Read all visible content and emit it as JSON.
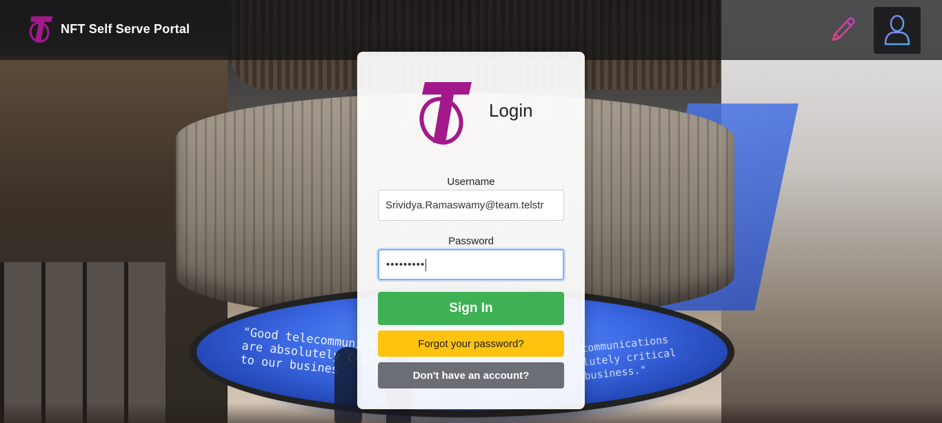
{
  "header": {
    "title": "NFT Self Serve Portal",
    "logo_icon": "telstra-t-logo",
    "edit_icon": "pencil-icon",
    "user_icon": "user-icon"
  },
  "login": {
    "title": "Login",
    "username_label": "Username",
    "username_value": "Srividya.Ramaswamy@team.telstr",
    "password_label": "Password",
    "password_mask": "•••••••••",
    "sign_in_label": "Sign In",
    "forgot_label": "Forgot your password?",
    "no_account_label": "Don't have an account?"
  },
  "background": {
    "quote_left_line1": "\"Good telecommunicat",
    "quote_left_line2": "are absolutely criti",
    "quote_left_line3": "to our busines",
    "quote_right_line1": "communications",
    "quote_right_line2": "lutely critical",
    "quote_right_line3": "business.\""
  },
  "colors": {
    "brand_magenta": "#a3198b",
    "sign_in": "#3db153",
    "forgot": "#ffc20e",
    "no_account": "#6b6e75",
    "header_bg": "#121214"
  }
}
